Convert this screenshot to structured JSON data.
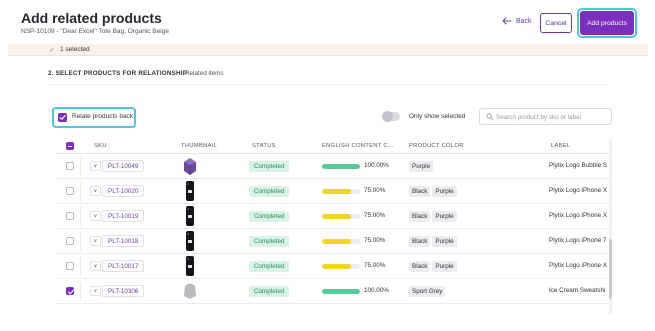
{
  "header": {
    "title": "Add related products",
    "subtitle": "NSP-10109 - \"Dear Excel\" Tote Bag, Organic Beige",
    "back_label": "Back",
    "cancel_label": "Cancel",
    "add_label": "Add products"
  },
  "selection": {
    "text": "1 selected"
  },
  "section": {
    "title": "2. SELECT PRODUCTS FOR RELATIONSHIP",
    "tab": "Related items"
  },
  "controls": {
    "relate_back_label": "Relate products back",
    "relate_back_checked": true,
    "only_selected_label": "Only show selected",
    "only_selected_on": false,
    "search_placeholder": "Search product by sku or label"
  },
  "table": {
    "headers": [
      "SKU",
      "THUMBNAIL",
      "STATUS",
      "ENGLISH CONTENT C...",
      "PRODUCT COLOR",
      "LABEL"
    ],
    "rows": [
      {
        "sku": "PLT-10049",
        "thumb": "purple-box",
        "status": "Completed",
        "progress": 100,
        "pct": "100.00%",
        "colors": [
          "Purple"
        ],
        "label": "Plytix Logo Bubble S",
        "checked": false
      },
      {
        "sku": "PLT-10020",
        "thumb": "phone-case",
        "status": "Completed",
        "progress": 75,
        "pct": "75.00%",
        "colors": [
          "Black",
          "Purple"
        ],
        "label": "Plytix Logo iPhone X",
        "checked": false
      },
      {
        "sku": "PLT-10019",
        "thumb": "phone-case",
        "status": "Completed",
        "progress": 75,
        "pct": "75.00%",
        "colors": [
          "Black",
          "Purple"
        ],
        "label": "Plytix Logo iPhone X",
        "checked": false
      },
      {
        "sku": "PLT-10018",
        "thumb": "phone-case",
        "status": "Completed",
        "progress": 75,
        "pct": "75.00%",
        "colors": [
          "Black",
          "Purple"
        ],
        "label": "Plytix Logo iPhone 7",
        "checked": false
      },
      {
        "sku": "PLT-10017",
        "thumb": "phone-case",
        "status": "Completed",
        "progress": 75,
        "pct": "75.00%",
        "colors": [
          "Black",
          "Purple"
        ],
        "label": "Plytix Logo iPhone X",
        "checked": false
      },
      {
        "sku": "PLT-10306",
        "thumb": "grey-item",
        "status": "Completed",
        "progress": 100,
        "pct": "100.00%",
        "colors": [
          "Sport Grey"
        ],
        "label": "Ice Cream Sweatshi",
        "checked": true
      }
    ]
  },
  "colors": {
    "accent": "#7a2fbf",
    "highlight_ring": "#4ec6e0",
    "status_green": "#1e8e5a",
    "bar_full": "#58c99a",
    "bar_partial": "#f2d429"
  },
  "icons": {
    "back": "back-arrow-icon",
    "search": "search-icon",
    "check": "check-icon",
    "expand": "chevron-down-icon"
  }
}
